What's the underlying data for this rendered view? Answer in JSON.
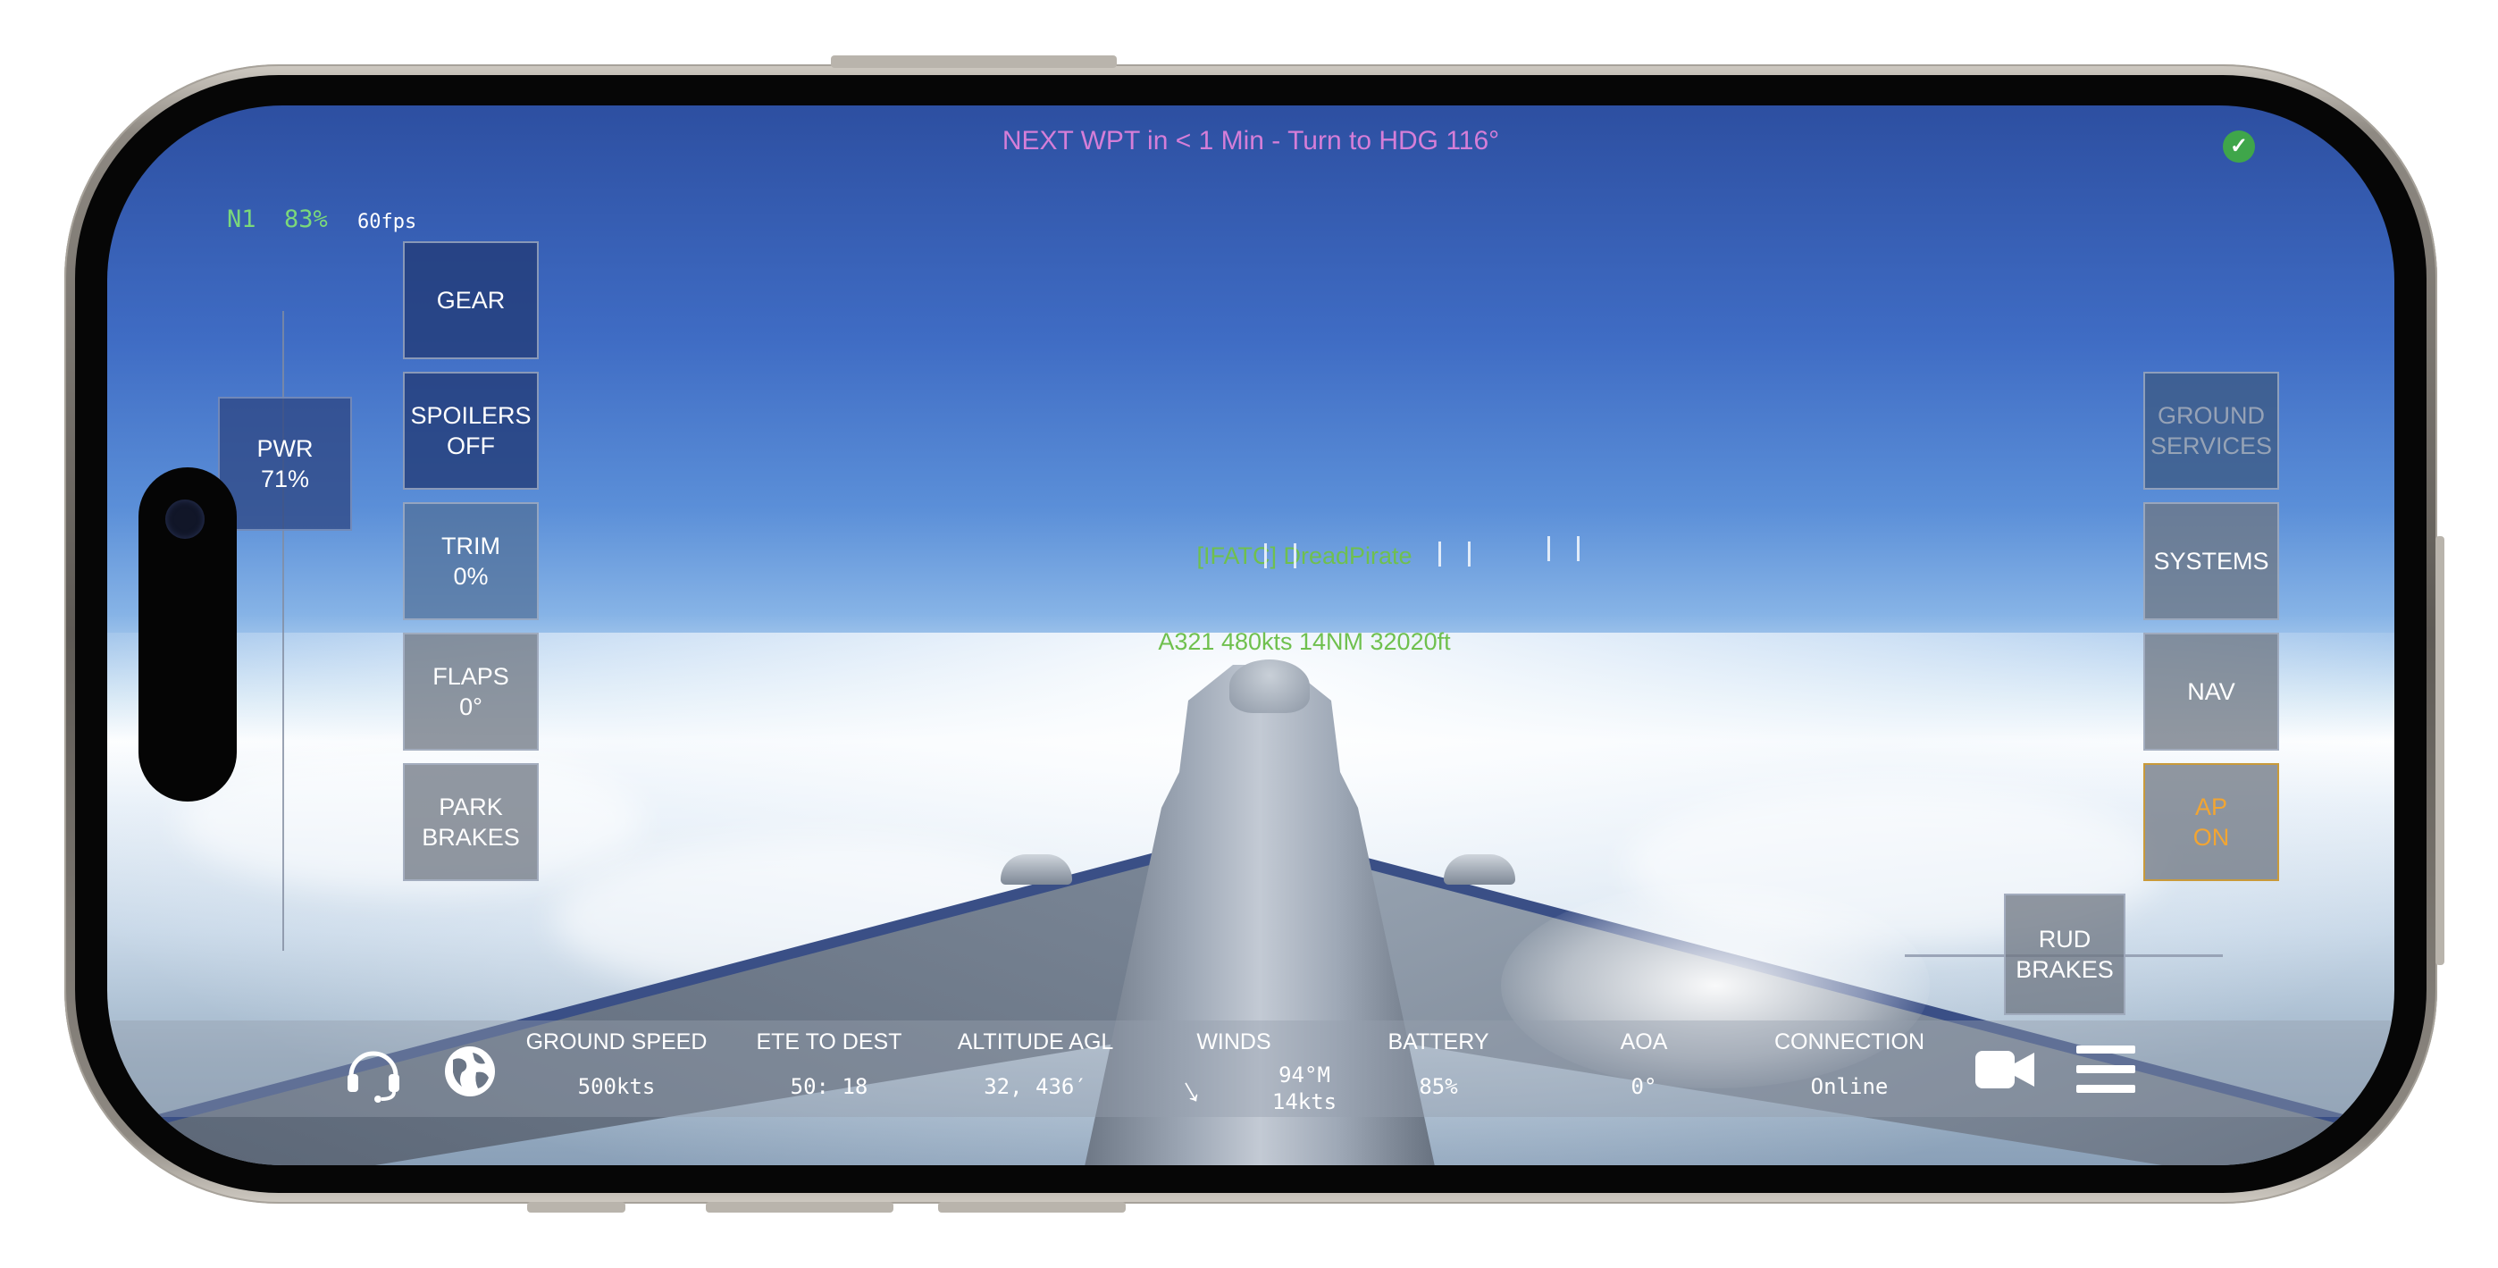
{
  "top_message": "NEXT WPT in < 1 Min - Turn to HDG 116°",
  "engine": {
    "n1_label": "N1",
    "n1_value": "83%",
    "fps": "60fps"
  },
  "power": {
    "label": "PWR",
    "value": "71%"
  },
  "controls": {
    "gear": "GEAR",
    "spoilers": [
      "SPOILERS",
      "OFF"
    ],
    "trim": [
      "TRIM",
      "0%"
    ],
    "flaps": [
      "FLAPS",
      "0°"
    ],
    "park_brakes": [
      "PARK",
      "BRAKES"
    ]
  },
  "right_controls": {
    "ground_services": [
      "GROUND",
      "SERVICES"
    ],
    "systems": "SYSTEMS",
    "nav": "NAV",
    "autopilot": [
      "AP",
      "ON"
    ],
    "rud_brakes": [
      "RUD",
      "BRAKES"
    ]
  },
  "traffic": {
    "callsign": "[IFATC] DreadPirate",
    "details": "A321 480kts 14NM 32020ft"
  },
  "info_bar": {
    "ground_speed": {
      "label": "GROUND SPEED",
      "value": "500kts"
    },
    "ete_to_dest": {
      "label": "ETE TO DEST",
      "value": "50: 18"
    },
    "altitude_agl": {
      "label": "ALTITUDE AGL",
      "value": "32, 436′"
    },
    "winds": {
      "label": "WINDS",
      "direction": "94°M",
      "speed": "14kts"
    },
    "battery": {
      "label": "BATTERY",
      "value": "85%"
    },
    "aoa": {
      "label": "AOA",
      "value": "0°"
    },
    "connection": {
      "label": "CONNECTION",
      "value": "Online"
    }
  },
  "icons": {
    "status": "check-circle-icon",
    "atc": "headset-icon",
    "map": "globe-icon",
    "camera": "video-camera-icon",
    "menu": "hamburger-menu-icon"
  },
  "colors": {
    "message": "#d57ed8",
    "n1": "#7bd87a",
    "traffic": "#6fc04e",
    "autopilot_on": "#f2a532",
    "status_ok": "#3fa64a"
  }
}
